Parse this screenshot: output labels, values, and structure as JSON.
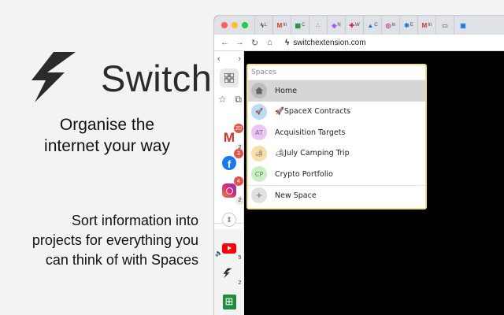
{
  "brand": {
    "name": "Switch"
  },
  "tagline": {
    "line1": "Organise the",
    "line2": "internet your way"
  },
  "description": {
    "line1": "Sort information into",
    "line2": "projects for everything you",
    "line3": "can think of with Spaces"
  },
  "browser": {
    "tabs": [
      {
        "icon": "switch-icon",
        "label": "L"
      },
      {
        "icon": "gmail-icon",
        "label": "In"
      },
      {
        "icon": "sheets-icon",
        "label": "C"
      },
      {
        "icon": "asana-icon",
        "label": ""
      },
      {
        "icon": "figma-icon",
        "label": "N"
      },
      {
        "icon": "slack-icon",
        "label": "W"
      },
      {
        "icon": "drive-icon",
        "label": "C"
      },
      {
        "icon": "instagram-icon",
        "label": "In"
      },
      {
        "icon": "puzzle-icon",
        "label": "E"
      },
      {
        "icon": "gmail-icon",
        "label": "In"
      },
      {
        "icon": "image-icon",
        "label": ""
      },
      {
        "icon": "calendar-icon",
        "label": ""
      }
    ],
    "url": "switchextension.com"
  },
  "sidebar": {
    "apps": [
      {
        "name": "gmail",
        "badge": "20",
        "count": "2"
      },
      {
        "name": "facebook",
        "badge": "3",
        "count": ""
      },
      {
        "name": "instagram",
        "badge": "4",
        "count": "2"
      }
    ],
    "lower_apps": [
      {
        "name": "youtube",
        "count": "5"
      },
      {
        "name": "switch",
        "count": "2"
      },
      {
        "name": "sheets",
        "count": ""
      }
    ]
  },
  "spaces": {
    "search_placeholder": "Spaces",
    "items": [
      {
        "label": "Home",
        "avatar": "",
        "color": "#bdbdbd"
      },
      {
        "label": "🚀SpaceX Contracts",
        "avatar": "🚀",
        "color": "#b7dcf5"
      },
      {
        "label": "Acquisition Targets",
        "avatar": "AT",
        "color": "#e8c7f0"
      },
      {
        "label": "🏕July Camping Trip",
        "avatar": "🏕",
        "color": "#f5e0a8"
      },
      {
        "label": "Crypto Portfolio",
        "avatar": "CP",
        "color": "#c9f0c2"
      }
    ],
    "new_label": "New Space"
  },
  "colors": {
    "accent_border": "#f3e27a",
    "badge_red": "#e5534b"
  }
}
